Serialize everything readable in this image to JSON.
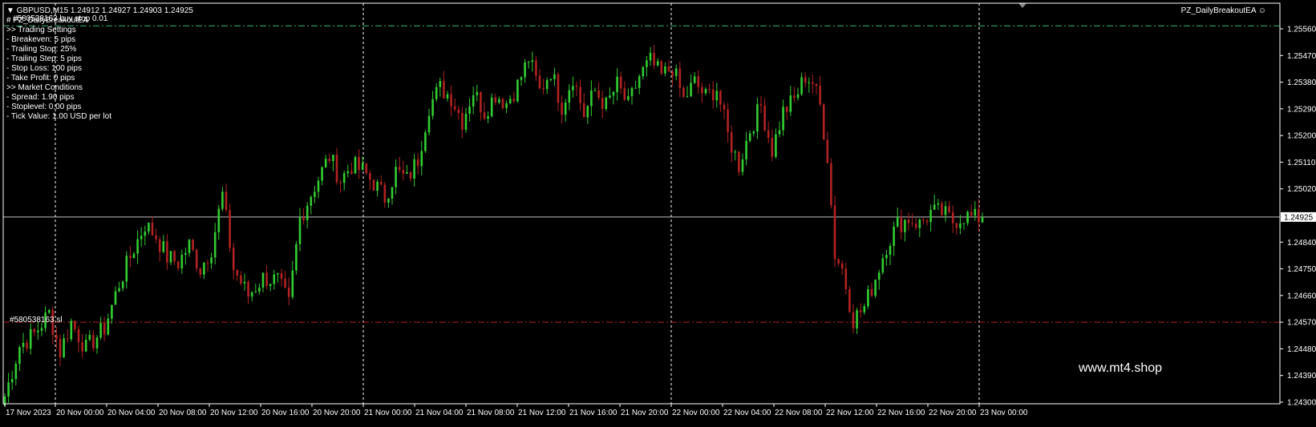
{
  "header": {
    "symbol_line": "GBPUSD,M15  1.24912 1.24927 1.24903 1.24925",
    "ea_name": "PZ_DailyBreakoutEA"
  },
  "order_labels": {
    "buy_stop": "#580538163 buy stop 0.01",
    "sl": "#580538163 sl"
  },
  "info_panel": [
    "# PZ_DailyBreakoutEA",
    ">> Trading Settings",
    "- Breakeven: 5 pips",
    "- Trailing Stop: 25%",
    "- Trailing Step: 5 pips",
    "- Stop Loss: 100 pips",
    "- Take Profit: 0 pips",
    ">> Market Conditions",
    "- Spread: 1.90 pips",
    "- Stoplevel: 0.00 pips",
    "- Tick Value: 1.00 USD per lot"
  ],
  "watermark": "www.mt4.shop",
  "colors": {
    "background": "#000000",
    "bull": "#32cd32",
    "bear": "#b22222",
    "grid_separator": "#ffffff",
    "buy_stop_line": "#3cb371",
    "stop_loss_line": "#b22222",
    "bid_line": "#c0c0c0",
    "text": "#ffffff"
  },
  "chart_data": {
    "type": "candlestick",
    "timeframe": "M15",
    "y_ticks": [
      "1.25560",
      "1.25470",
      "1.25380",
      "1.25290",
      "1.25200",
      "1.25110",
      "1.25020",
      "1.24925",
      "1.24840",
      "1.24750",
      "1.24660",
      "1.24570",
      "1.24480",
      "1.24390",
      "1.24300"
    ],
    "current_price": "1.24925",
    "buy_stop_price": 1.2557,
    "stop_loss_price": 1.2457,
    "ylim": [
      1.2429,
      1.2565
    ],
    "x_ticks": [
      "17 Nov 2023",
      "20 Nov 00:00",
      "20 Nov 04:00",
      "20 Nov 08:00",
      "20 Nov 12:00",
      "20 Nov 16:00",
      "20 Nov 20:00",
      "21 Nov 00:00",
      "21 Nov 04:00",
      "21 Nov 08:00",
      "21 Nov 12:00",
      "21 Nov 16:00",
      "21 Nov 20:00",
      "22 Nov 00:00",
      "22 Nov 04:00",
      "22 Nov 08:00",
      "22 Nov 12:00",
      "22 Nov 16:00",
      "22 Nov 20:00",
      "23 Nov 00:00"
    ],
    "day_separators": [
      "20 Nov 00:00",
      "21 Nov 00:00",
      "22 Nov 00:00",
      "23 Nov 00:00"
    ],
    "close_path": [
      [
        0,
        1.2432
      ],
      [
        4,
        1.2449
      ],
      [
        8,
        1.2453
      ],
      [
        12,
        1.246
      ],
      [
        15,
        1.2447
      ],
      [
        18,
        1.2457
      ],
      [
        22,
        1.2448
      ],
      [
        27,
        1.2455
      ],
      [
        31,
        1.247
      ],
      [
        35,
        1.2482
      ],
      [
        38,
        1.249
      ],
      [
        41,
        1.2486
      ],
      [
        44,
        1.2479
      ],
      [
        47,
        1.2477
      ],
      [
        50,
        1.2483
      ],
      [
        53,
        1.2475
      ],
      [
        56,
        1.2482
      ],
      [
        59,
        1.25
      ],
      [
        62,
        1.2475
      ],
      [
        66,
        1.2466
      ],
      [
        70,
        1.2472
      ],
      [
        74,
        1.2471
      ],
      [
        77,
        1.2463
      ],
      [
        80,
        1.2492
      ],
      [
        84,
        1.2503
      ],
      [
        88,
        1.2513
      ],
      [
        91,
        1.2505
      ],
      [
        94,
        1.251
      ],
      [
        97,
        1.2508
      ],
      [
        100,
        1.2504
      ],
      [
        103,
        1.2499
      ],
      [
        106,
        1.2508
      ],
      [
        109,
        1.2505
      ],
      [
        112,
        1.2512
      ],
      [
        115,
        1.253
      ],
      [
        118,
        1.2536
      ],
      [
        121,
        1.2533
      ],
      [
        124,
        1.2525
      ],
      [
        127,
        1.2535
      ],
      [
        130,
        1.2528
      ],
      [
        133,
        1.2534
      ],
      [
        136,
        1.2531
      ],
      [
        139,
        1.2537
      ],
      [
        142,
        1.2546
      ],
      [
        145,
        1.2535
      ],
      [
        148,
        1.2542
      ],
      [
        151,
        1.253
      ],
      [
        154,
        1.254
      ],
      [
        157,
        1.2527
      ],
      [
        160,
        1.2535
      ],
      [
        163,
        1.253
      ],
      [
        166,
        1.2537
      ],
      [
        169,
        1.253
      ],
      [
        172,
        1.254
      ],
      [
        175,
        1.2545
      ],
      [
        178,
        1.254
      ],
      [
        181,
        1.2543
      ],
      [
        184,
        1.2532
      ],
      [
        187,
        1.2538
      ],
      [
        190,
        1.2533
      ],
      [
        193,
        1.2536
      ],
      [
        196,
        1.252
      ],
      [
        199,
        1.251
      ],
      [
        202,
        1.2522
      ],
      [
        205,
        1.253
      ],
      [
        208,
        1.2515
      ],
      [
        211,
        1.2528
      ],
      [
        214,
        1.2532
      ],
      [
        217,
        1.254
      ],
      [
        219,
        1.2538
      ],
      [
        221,
        1.253
      ],
      [
        223,
        1.2513
      ],
      [
        225,
        1.248
      ],
      [
        227,
        1.2475
      ],
      [
        230,
        1.2458
      ],
      [
        233,
        1.2462
      ],
      [
        236,
        1.2472
      ],
      [
        239,
        1.2483
      ],
      [
        242,
        1.249
      ],
      [
        245,
        1.2492
      ],
      [
        248,
        1.249
      ],
      [
        251,
        1.2494
      ],
      [
        254,
        1.2494
      ],
      [
        257,
        1.2491
      ],
      [
        260,
        1.2493
      ],
      [
        263,
        1.2492
      ],
      [
        265,
        1.24925
      ]
    ]
  }
}
